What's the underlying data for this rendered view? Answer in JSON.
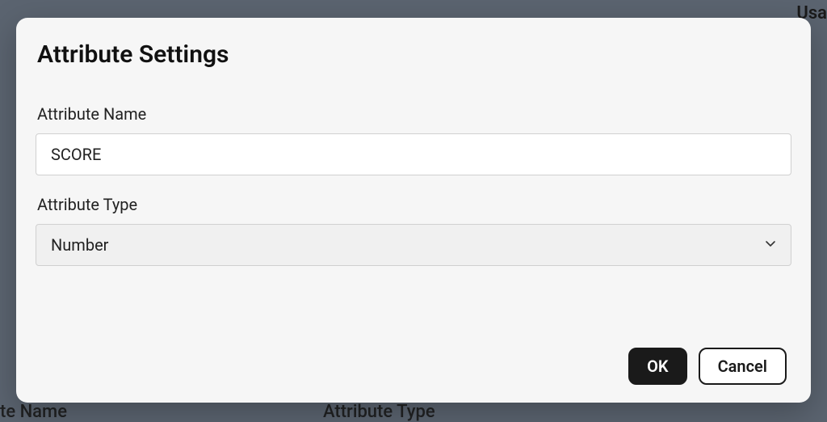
{
  "background": {
    "topRight": "Usa",
    "bottomLeft": "te Name",
    "bottomMid": "Attribute Type"
  },
  "dialog": {
    "title": "Attribute Settings",
    "nameLabel": "Attribute Name",
    "nameValue": "SCORE",
    "typeLabel": "Attribute Type",
    "typeValue": "Number",
    "okLabel": "OK",
    "cancelLabel": "Cancel"
  }
}
